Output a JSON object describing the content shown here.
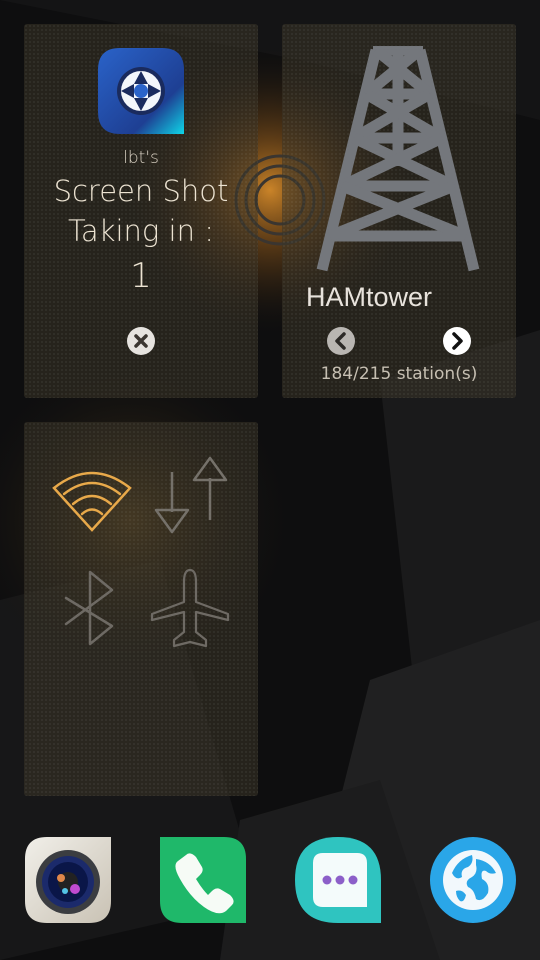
{
  "screenshot_widget": {
    "app_icon": "camera-shutter-icon",
    "author": "lbt's",
    "title": "Screen Shot",
    "subtitle": "Taking in :",
    "countdown": "1",
    "close_icon": "close-icon"
  },
  "hamtower_widget": {
    "icon": "radio-tower-icon",
    "title": "HAMtower",
    "prev_icon": "chevron-left-icon",
    "next_icon": "chevron-right-icon",
    "station_count": "184/215 station(s)"
  },
  "quick_toggles": [
    {
      "name": "wifi",
      "icon": "wifi-icon",
      "active": true
    },
    {
      "name": "mobile-data",
      "icon": "mobile-data-icon",
      "active": false
    },
    {
      "name": "bluetooth",
      "icon": "bluetooth-icon",
      "active": false
    },
    {
      "name": "flight-mode",
      "icon": "airplane-icon",
      "active": false
    }
  ],
  "dock": [
    {
      "name": "camera",
      "icon": "camera-icon"
    },
    {
      "name": "phone",
      "icon": "phone-icon"
    },
    {
      "name": "messages",
      "icon": "messages-icon"
    },
    {
      "name": "browser",
      "icon": "browser-icon"
    }
  ],
  "colors": {
    "accent": "#e8a94a",
    "card_bg": "#3a3428",
    "phone_green": "#1fb86a",
    "messages_teal": "#2fc4c0",
    "browser_blue": "#2aa6e8"
  }
}
